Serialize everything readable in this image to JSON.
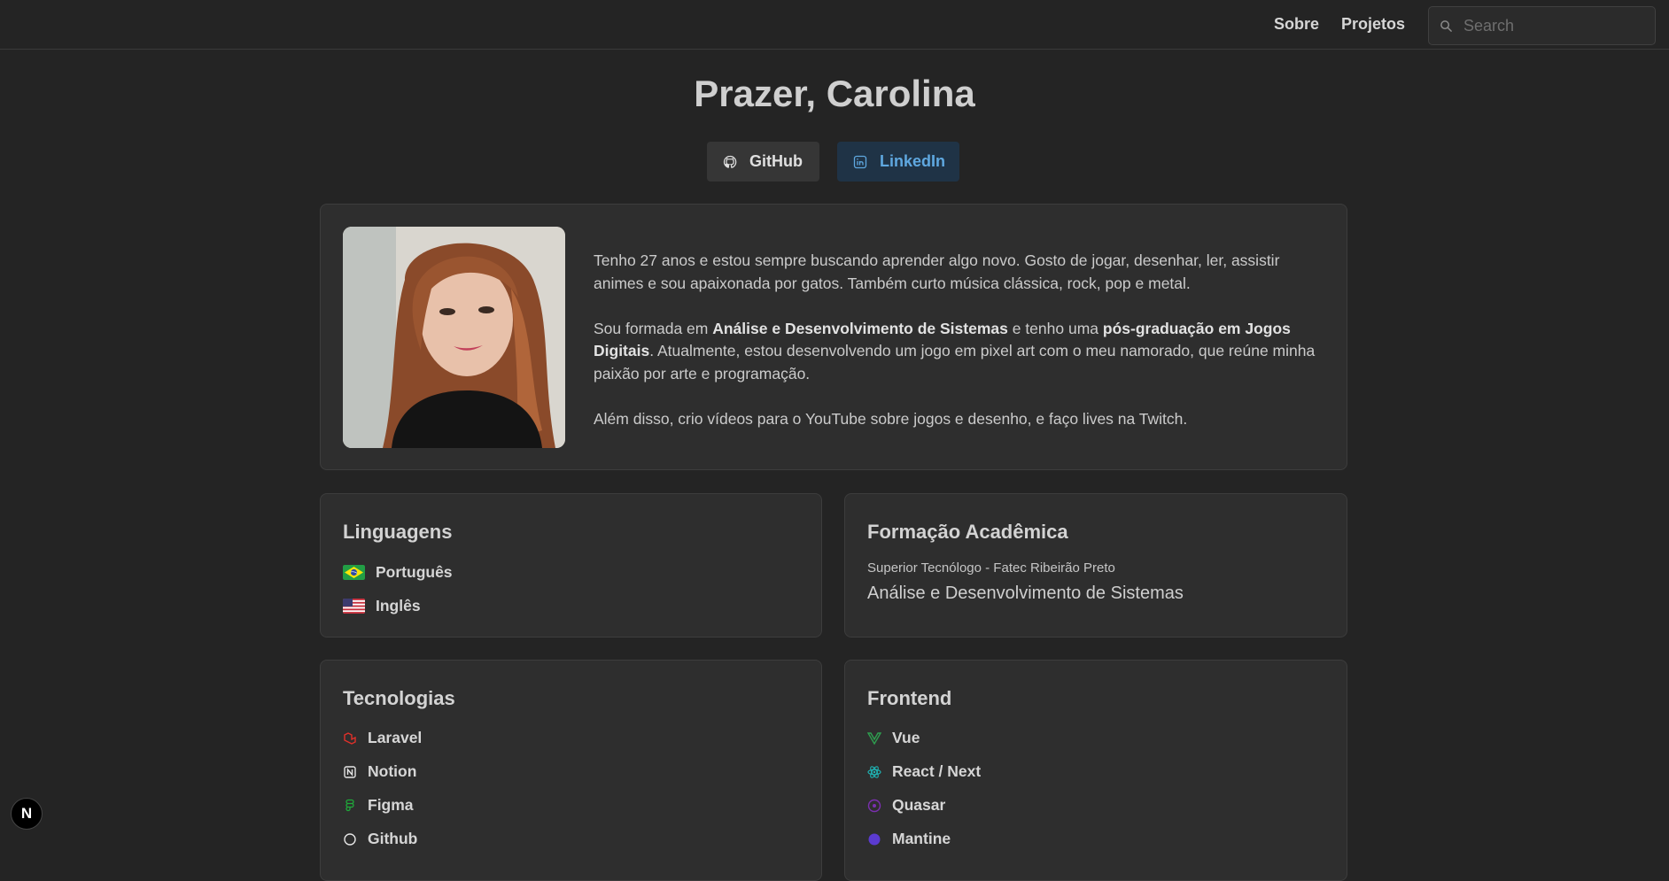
{
  "nav": {
    "about_label": "Sobre",
    "projects_label": "Projetos",
    "search_placeholder": "Search"
  },
  "hero": {
    "title": "Prazer, Carolina",
    "github_label": "GitHub",
    "linkedin_label": "LinkedIn"
  },
  "about": {
    "p1": "Tenho 27 anos e estou sempre buscando aprender algo novo. Gosto de jogar, desenhar, ler, assistir animes e sou apaixonada por gatos. Também curto música clássica, rock, pop e metal.",
    "p2_a": "Sou formada em ",
    "p2_b": "Análise e Desenvolvimento de Sistemas",
    "p2_c": " e tenho uma ",
    "p2_d": "pós-graduação em Jogos Digitais",
    "p2_e": ". Atualmente, estou desenvolvendo um jogo em pixel art com o meu namorado, que reúne minha paixão por arte e programação.",
    "p3": "Além disso, crio vídeos para o YouTube sobre jogos e desenho, e faço lives na Twitch."
  },
  "languages": {
    "title": "Linguagens",
    "items": [
      {
        "label": "Português",
        "icon": "brazil-flag-icon"
      },
      {
        "label": "Inglês",
        "icon": "usa-flag-icon"
      }
    ]
  },
  "education": {
    "title": "Formação Acadêmica",
    "subtitle": "Superior Tecnólogo - Fatec Ribeirão Preto",
    "course": "Análise e Desenvolvimento de Sistemas"
  },
  "technologies": {
    "title": "Tecnologias",
    "items": [
      {
        "label": "Laravel",
        "icon": "laravel-icon",
        "color": "#e0302a"
      },
      {
        "label": "Notion",
        "icon": "notion-icon",
        "color": "#e6e6e6"
      },
      {
        "label": "Figma",
        "icon": "figma-icon",
        "color": "#1faa3a"
      },
      {
        "label": "Github",
        "icon": "github-icon",
        "color": "#e6e6e6"
      }
    ]
  },
  "frontend": {
    "title": "Frontend",
    "items": [
      {
        "label": "Vue",
        "icon": "vue-icon",
        "color": "#2e9e4f"
      },
      {
        "label": "React / Next",
        "icon": "react-icon",
        "color": "#1fb3b3"
      },
      {
        "label": "Quasar",
        "icon": "quasar-icon",
        "color": "#7b2fb0"
      },
      {
        "label": "Mantine",
        "icon": "mantine-icon",
        "color": "#5b3bd0"
      }
    ]
  },
  "badge": {
    "label": "N"
  }
}
